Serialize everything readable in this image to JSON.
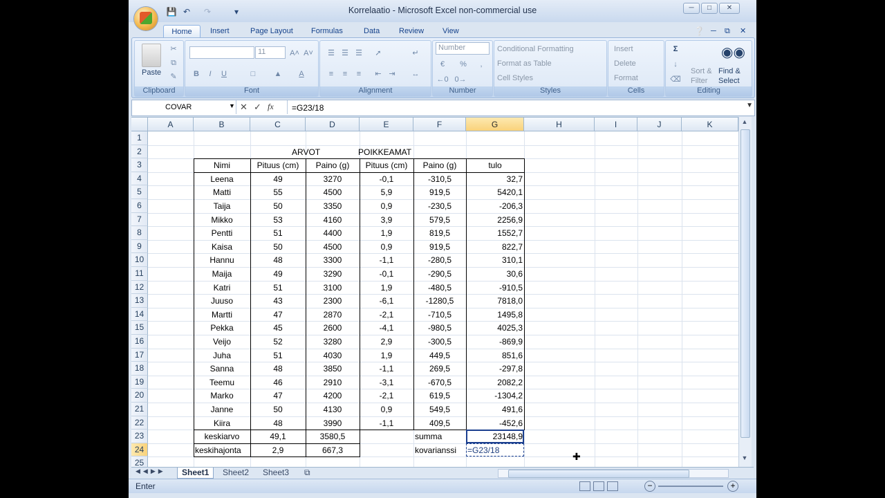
{
  "window": {
    "title": "Korrelaatio - Microsoft Excel non-commercial use"
  },
  "tabs": [
    "Home",
    "Insert",
    "Page Layout",
    "Formulas",
    "Data",
    "Review",
    "View"
  ],
  "ribbon": {
    "clipboard": {
      "label": "Clipboard",
      "paste": "Paste"
    },
    "font": {
      "label": "Font",
      "size": "11"
    },
    "alignment": {
      "label": "Alignment"
    },
    "number": {
      "label": "Number",
      "format": "Number",
      "percent": "%"
    },
    "styles": {
      "label": "Styles",
      "conditional": "Conditional Formatting",
      "format_table": "Format as Table",
      "cell_styles": "Cell Styles"
    },
    "cells": {
      "label": "Cells",
      "insert": "Insert",
      "delete": "Delete",
      "format": "Format"
    },
    "editing": {
      "label": "Editing",
      "sort": "Sort &",
      "filter": "Filter",
      "find": "Find &",
      "select": "Select"
    }
  },
  "formula_bar": {
    "name_box": "COVAR",
    "formula": "=G23/18"
  },
  "columns": [
    "A",
    "B",
    "C",
    "D",
    "E",
    "F",
    "G",
    "H",
    "I",
    "J",
    "K"
  ],
  "rows": [
    "1",
    "2",
    "3",
    "4",
    "5",
    "6",
    "7",
    "8",
    "9",
    "10",
    "11",
    "12",
    "13",
    "14",
    "15",
    "16",
    "17",
    "18",
    "19",
    "20",
    "21",
    "22",
    "23",
    "24",
    "25"
  ],
  "sheet": {
    "header_arvot": "ARVOT",
    "header_poikkeamat": "POIKKEAMAT",
    "col_headers": [
      "Nimi",
      "Pituus (cm)",
      "Paino (g)",
      "Pituus (cm)",
      "Paino (g)",
      "tulo"
    ],
    "data_rows": [
      [
        "Leena",
        "49",
        "3270",
        "-0,1",
        "-310,5",
        "32,7"
      ],
      [
        "Matti",
        "55",
        "4500",
        "5,9",
        "919,5",
        "5420,1"
      ],
      [
        "Taija",
        "50",
        "3350",
        "0,9",
        "-230,5",
        "-206,3"
      ],
      [
        "Mikko",
        "53",
        "4160",
        "3,9",
        "579,5",
        "2256,9"
      ],
      [
        "Pentti",
        "51",
        "4400",
        "1,9",
        "819,5",
        "1552,7"
      ],
      [
        "Kaisa",
        "50",
        "4500",
        "0,9",
        "919,5",
        "822,7"
      ],
      [
        "Hannu",
        "48",
        "3300",
        "-1,1",
        "-280,5",
        "310,1"
      ],
      [
        "Maija",
        "49",
        "3290",
        "-0,1",
        "-290,5",
        "30,6"
      ],
      [
        "Katri",
        "51",
        "3100",
        "1,9",
        "-480,5",
        "-910,5"
      ],
      [
        "Juuso",
        "43",
        "2300",
        "-6,1",
        "-1280,5",
        "7818,0"
      ],
      [
        "Martti",
        "47",
        "2870",
        "-2,1",
        "-710,5",
        "1495,8"
      ],
      [
        "Pekka",
        "45",
        "2600",
        "-4,1",
        "-980,5",
        "4025,3"
      ],
      [
        "Veijo",
        "52",
        "3280",
        "2,9",
        "-300,5",
        "-869,9"
      ],
      [
        "Juha",
        "51",
        "4030",
        "1,9",
        "449,5",
        "851,6"
      ],
      [
        "Sanna",
        "48",
        "3850",
        "-1,1",
        "269,5",
        "-297,8"
      ],
      [
        "Teemu",
        "46",
        "2910",
        "-3,1",
        "-670,5",
        "2082,2"
      ],
      [
        "Marko",
        "47",
        "4200",
        "-2,1",
        "619,5",
        "-1304,2"
      ],
      [
        "Janne",
        "50",
        "4130",
        "0,9",
        "549,5",
        "491,6"
      ],
      [
        "Kiira",
        "48",
        "3990",
        "-1,1",
        "409,5",
        "-452,6"
      ]
    ],
    "summary": {
      "keskiarvo_label": "keskiarvo",
      "keskiarvo_c": "49,1",
      "keskiarvo_d": "3580,5",
      "keskihajonta_label": "keskihajonta",
      "keskihajonta_c": "2,9",
      "keskihajonta_d": "667,3",
      "summa_label": "summa",
      "summa_value": "23148,9",
      "kovarianssi_label": "kovarianssi",
      "kovarianssi_value": "=G23/18"
    }
  },
  "sheet_tabs": [
    "Sheet1",
    "Sheet2",
    "Sheet3"
  ],
  "status": {
    "mode": "Enter"
  }
}
